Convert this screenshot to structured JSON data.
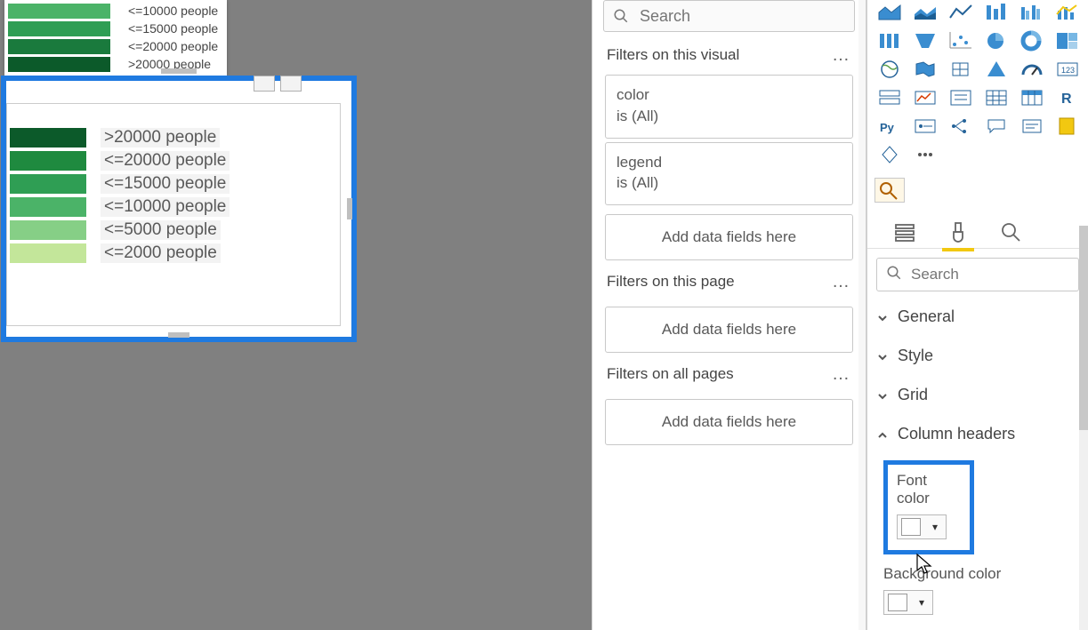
{
  "canvas": {
    "legend_top": [
      {
        "color": "#4bb368",
        "label": "<=10000 people"
      },
      {
        "color": "#2f9e54",
        "label": "<=15000 people"
      },
      {
        "color": "#1a7a3d",
        "label": "<=20000 people"
      },
      {
        "color": "#0c5a2a",
        "label": ">20000 people"
      }
    ],
    "legend_main": [
      {
        "color": "#0c5a2a",
        "label": ">20000 people"
      },
      {
        "color": "#1f8a3f",
        "label": "<=20000 people"
      },
      {
        "color": "#2f9e54",
        "label": "<=15000 people"
      },
      {
        "color": "#4bb368",
        "label": "<=10000 people"
      },
      {
        "color": "#86cf86",
        "label": "<=5000 people"
      },
      {
        "color": "#c3e69a",
        "label": "<=2000 people"
      }
    ]
  },
  "filters": {
    "search_placeholder": "Search",
    "sections": {
      "visual": {
        "title": "Filters on this visual",
        "cards": [
          {
            "field": "color",
            "state": "is (All)"
          },
          {
            "field": "legend",
            "state": "is (All)"
          }
        ],
        "add": "Add data fields here"
      },
      "page": {
        "title": "Filters on this page",
        "add": "Add data fields here"
      },
      "allpages": {
        "title": "Filters on all pages",
        "add": "Add data fields here"
      }
    }
  },
  "viz": {
    "search_placeholder": "Search",
    "accordion": [
      {
        "label": "General",
        "open": false
      },
      {
        "label": "Style",
        "open": false
      },
      {
        "label": "Grid",
        "open": false
      },
      {
        "label": "Column headers",
        "open": true
      }
    ],
    "font_color_label": "Font color",
    "bg_color_label": "Background color"
  }
}
